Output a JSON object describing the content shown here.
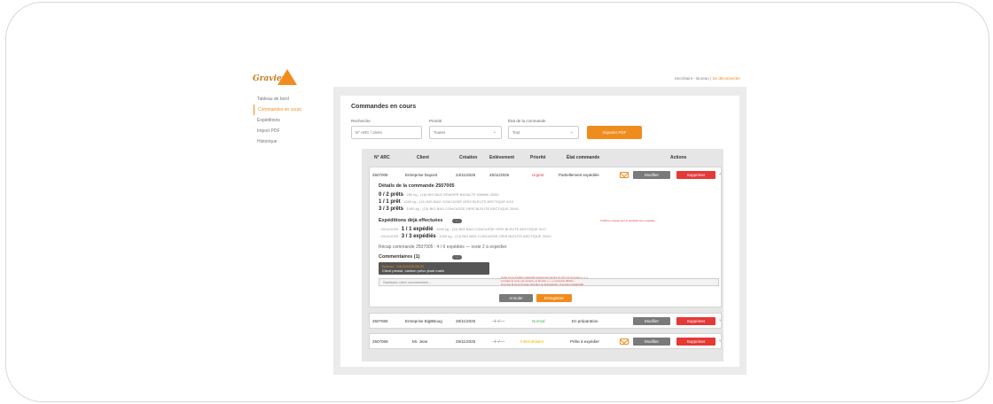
{
  "brand": {
    "logo_text": "Gravier"
  },
  "header": {
    "user": "Secrétaire - Bureau",
    "separator": "|",
    "logout": "Se déconnecter"
  },
  "sidebar": {
    "items": [
      {
        "label": "Tableau de bord"
      },
      {
        "label": "Commandes en cours",
        "active": true
      },
      {
        "label": "Expéditions"
      },
      {
        "label": "Import PDF"
      },
      {
        "label": "Historique"
      }
    ]
  },
  "main": {
    "title": "Commandes en cours",
    "filters": {
      "search_label": "Recherche",
      "search_placeholder": "N° ARC / client",
      "priority_label": "Priorité",
      "priority_value": "Toutes",
      "status_label": "État de la commande",
      "status_value": "Tout",
      "import_button": "Importer PDF"
    },
    "table": {
      "headers": [
        "N° ARC",
        "Client",
        "Création",
        "Enlèvement",
        "Priorité",
        "État commande",
        "Actions"
      ],
      "rows": [
        {
          "arc": "2507005",
          "client": "Entreprise Dupont",
          "created": "24/11/2025",
          "pickup": "25/11/2025",
          "priority": "Urgent",
          "status": "Partiellement expédiée",
          "modify": "Modifier",
          "delete": "Supprimer"
        },
        {
          "arc": "2507065",
          "client": "Entreprise BigBBoug",
          "created": "28/11/2025",
          "pickup": "--/--/----",
          "priority": "Normal",
          "status": "En préparation",
          "modify": "Modifier",
          "delete": "Supprimer"
        },
        {
          "arc": "2507069",
          "client": "Mr. Jean",
          "created": "29/11/2025",
          "pickup": "--/--/----",
          "priority": "Intermédiaire",
          "status": "Prête à expédier",
          "modify": "Modifier",
          "delete": "Supprimer"
        }
      ]
    },
    "details": {
      "title": "Détails de la commande 2507005",
      "lines": [
        {
          "count": "0 / 2 prêts",
          "text": "· 250 kg - (16) BIG BAG GRAVIER BASALTE HAWAII 30/50"
        },
        {
          "count": "1 / 1 prêt",
          "text": "· 1000 kg - (11) BIG BAG CONCASSE GRIS BLEUTE ARCTIQUE 6/10"
        },
        {
          "count": "3 / 3 prêts",
          "text": "· 1000 kg - (13) BIG BAG CONCASSE GRIS BLEUTE ARCTIQUE 20/40"
        }
      ],
      "shipments_title": "Expéditions déjà effectuées",
      "shipments_note": "S'affiche uniquement si partiellement expédiée",
      "shipments": [
        {
          "date": "· 24/11/2025 ·",
          "count": "1 / 1 expédié",
          "text": "· 1000 kg - (11) BIG BAG CONCASSE GRIS BLEUTE ARCTIQUE 6/10"
        },
        {
          "date": "· 24/11/2025 ·",
          "count": "3 / 3 expédiés",
          "text": "· 1000 kg - (13) BIG BAG CONCASSE GRIS BLEUTE ARCTIQUE 20/40"
        }
      ],
      "recap": "Récap commande 2507005 : 4 / 6 expédiés — reste 2 à expédier",
      "comments_title": "Commentaires (1)",
      "comment": {
        "meta": "Bureau · 24/11/2025 08:32",
        "text": "Client pressé, camion prévu jeudi matin"
      },
      "comment_placeholder": "Saisissez votre commentaire...",
      "comment_notes": [
        "Cette zone d'édition apparaît uniquement après un clic sur le bouton « + »",
        "Lorsque la zone est ouverte, le bouton « + » n'est plus affiché",
        "Une fois la zone fermée (Annuler ou Enregistrer), le bouton réapparaît"
      ],
      "cancel": "Annuler",
      "save": "Enregistrer"
    }
  },
  "colors": {
    "accent": "#f08c1e",
    "danger": "#e53935",
    "gray_button": "#7a7a7a"
  }
}
